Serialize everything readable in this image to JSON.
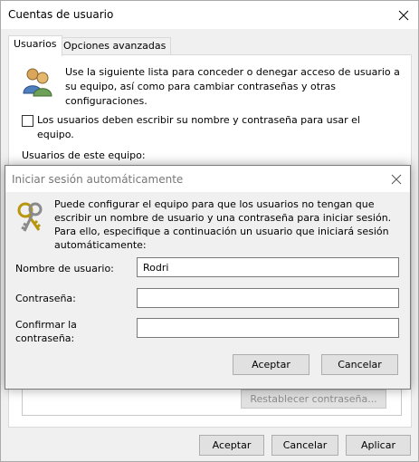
{
  "window": {
    "title": "Cuentas de usuario"
  },
  "tabs": [
    {
      "label": "Usuarios",
      "active": true
    },
    {
      "label": "Opciones avanzadas",
      "active": false
    }
  ],
  "users_tab": {
    "intro": "Use la siguiente lista para conceder o denegar acceso de usuario a su equipo, así como para cambiar contraseñas y otras configuraciones.",
    "require_login_checkbox": {
      "checked": false,
      "label": "Los usuarios deben escribir su nombre y contraseña para usar el equipo."
    },
    "users_heading": "Usuarios de este equipo:",
    "reset_password_button": "Restablecer contraseña..."
  },
  "main_buttons": {
    "ok": "Aceptar",
    "cancel": "Cancelar",
    "apply": "Aplicar"
  },
  "dialog": {
    "title": "Iniciar sesión automáticamente",
    "description": "Puede configurar el equipo para que los usuarios no tengan que escribir un nombre de usuario y una contraseña para iniciar sesión. Para ello, especifique a continuación un usuario que iniciará sesión automáticamente:",
    "fields": {
      "username": {
        "label": "Nombre de usuario:",
        "value": "Rodri"
      },
      "password": {
        "label": "Contraseña:",
        "value": ""
      },
      "confirm": {
        "label": "Confirmar la contraseña:",
        "value": ""
      }
    },
    "buttons": {
      "ok": "Aceptar",
      "cancel": "Cancelar"
    }
  },
  "icons": {
    "users": "users-icon",
    "keys": "keys-icon",
    "close": "close-icon"
  },
  "colors": {
    "window_bg": "#f0f0f0",
    "button_bg": "#e1e1e1",
    "disabled_text": "#8c8c8c",
    "dialog_title": "#777777"
  }
}
